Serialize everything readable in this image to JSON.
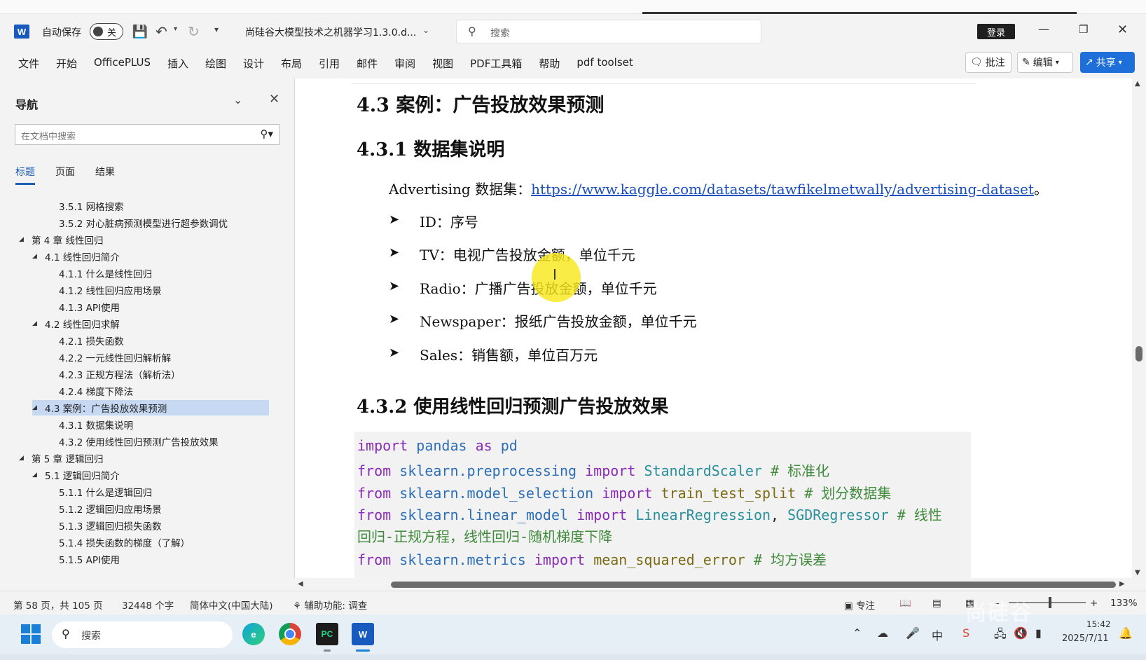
{
  "app": {
    "autosave_label": "自动保存",
    "autosave_state": "关",
    "document_title": "尚硅谷大模型技术之机器学习1.3.0.d...",
    "search_placeholder": "搜索",
    "login_label": "登录",
    "word_logo": "W"
  },
  "ribbon": {
    "tabs": [
      "文件",
      "开始",
      "OfficePLUS",
      "插入",
      "绘图",
      "设计",
      "布局",
      "引用",
      "邮件",
      "审阅",
      "视图",
      "PDF工具箱",
      "帮助",
      "pdf toolset"
    ],
    "comments_label": "批注",
    "editing_label": "编辑",
    "share_label": "共享"
  },
  "nav": {
    "title": "导航",
    "search_placeholder": "在文档中搜索",
    "tabs": [
      "标题",
      "页面",
      "结果"
    ],
    "items": [
      {
        "text": "3.5.1 网格搜索"
      },
      {
        "text": "3.5.2 对心脏病预测模型进行超参数调优"
      },
      {
        "text": "第 4 章 线性回归"
      },
      {
        "text": "4.1 线性回归简介"
      },
      {
        "text": "4.1.1 什么是线性回归"
      },
      {
        "text": "4.1.2 线性回归应用场景"
      },
      {
        "text": "4.1.3 API使用"
      },
      {
        "text": "4.2 线性回归求解"
      },
      {
        "text": "4.2.1 损失函数"
      },
      {
        "text": "4.2.2 一元线性回归解析解"
      },
      {
        "text": "4.2.3 正规方程法（解析法）"
      },
      {
        "text": "4.2.4 梯度下降法"
      },
      {
        "text": "4.3 案例：广告投放效果预测"
      },
      {
        "text": "4.3.1 数据集说明"
      },
      {
        "text": "4.3.2 使用线性回归预测广告投放效果"
      },
      {
        "text": "第 5 章 逻辑回归"
      },
      {
        "text": "5.1 逻辑回归简介"
      },
      {
        "text": "5.1.1 什么是逻辑回归"
      },
      {
        "text": "5.1.2 逻辑回归应用场景"
      },
      {
        "text": "5.1.3 逻辑回归损失函数"
      },
      {
        "text": "5.1.4 损失函数的梯度（了解）"
      },
      {
        "text": "5.1.5 API使用"
      }
    ]
  },
  "document": {
    "h2": "4.3 案例：广告投放效果预测",
    "h3_1": "4.3.1 数据集说明",
    "dataset_prefix": "Advertising 数据集：",
    "dataset_url": "https://www.kaggle.com/datasets/tawfikelmetwally/advertising-dataset",
    "dataset_suffix": "。",
    "bullets": [
      "ID：序号",
      "TV：电视广告投放金额，单位千元",
      "Radio：广播广告投放金额，单位千元",
      "Newspaper：报纸广告投放金额，单位千元",
      "Sales：销售额，单位百万元"
    ],
    "h3_2": "4.3.2 使用线性回归预测广告投放效果",
    "code": {
      "l1": {
        "kw1": "import",
        "mod": "pandas",
        "kw2": "as",
        "alias": "pd"
      },
      "l2": {
        "kw1": "from",
        "mod": "sklearn.preprocessing",
        "kw2": "import",
        "name": "StandardScaler",
        "comment": "# 标准化"
      },
      "l3": {
        "kw1": "from",
        "mod": "sklearn.model_selection",
        "kw2": "import",
        "name": "train_test_split",
        "comment": "# 划分数据集"
      },
      "l4": {
        "kw1": "from",
        "mod": "sklearn.linear_model",
        "kw2": "import",
        "name": "LinearRegression",
        "name2": "SGDRegressor",
        "comment": "# 线性"
      },
      "l5": {
        "comment": "回归-正规方程，线性回归-随机梯度下降"
      },
      "l6": {
        "kw1": "from",
        "mod": "sklearn.metrics",
        "kw2": "import",
        "name": "mean_squared_error",
        "comment": "# 均方误差"
      }
    }
  },
  "status": {
    "page_info": "第 58 页，共 105 页",
    "word_count": "32448 个字",
    "language": "简体中文(中国大陆)",
    "accessibility": "辅助功能: 调查",
    "focus_label": "专注",
    "zoom": "133%"
  },
  "taskbar": {
    "search_placeholder": "搜索",
    "time": "15:42",
    "date": "2025/7/11",
    "watermark": "尚硅谷"
  },
  "colors": {
    "accent": "#1e6fd9",
    "nav_selection": "#c7d8f3",
    "link": "#1a4fc2",
    "highlight": "#f8e81c"
  }
}
